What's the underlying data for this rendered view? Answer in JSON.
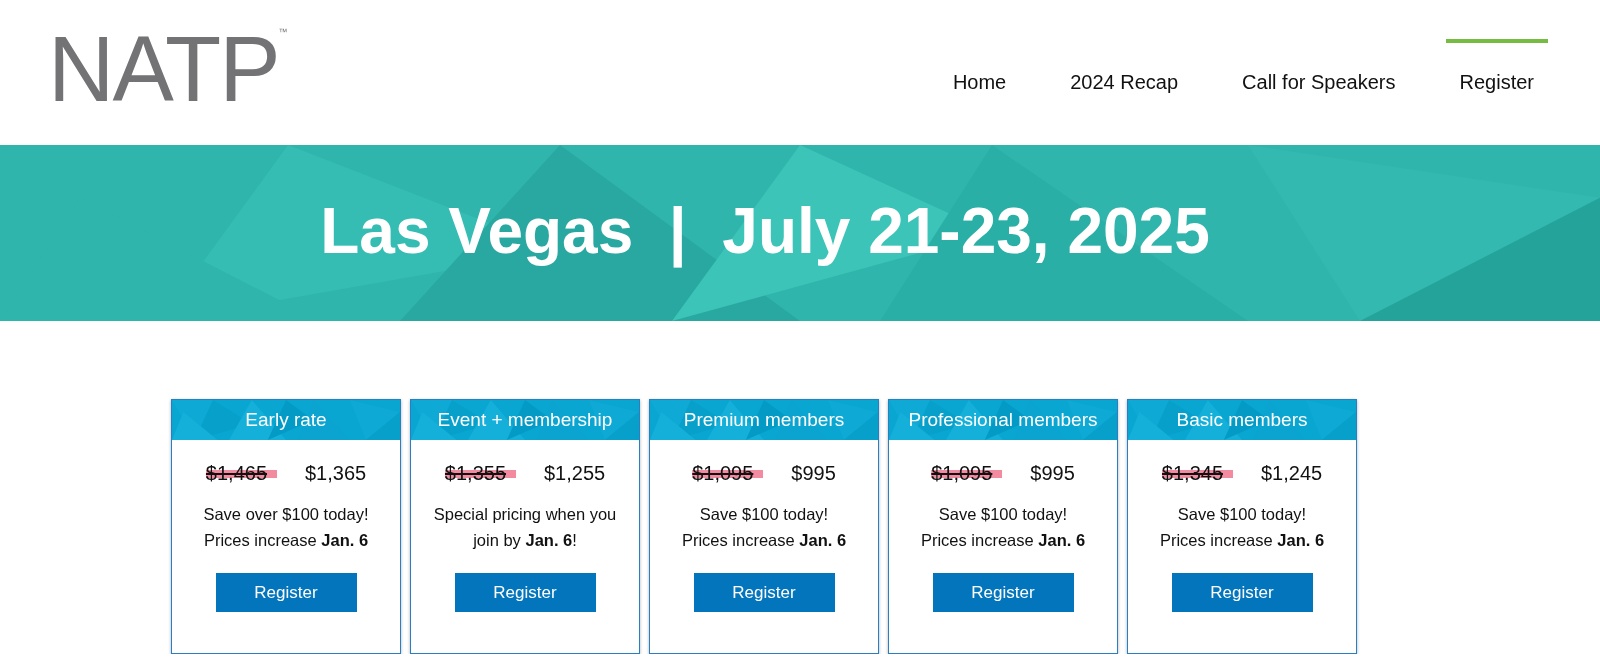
{
  "logo": {
    "text": "NATP",
    "mark": "™"
  },
  "nav": [
    {
      "label": "Home",
      "selected": false
    },
    {
      "label": "2024 Recap",
      "selected": false
    },
    {
      "label": "Call for Speakers",
      "selected": false
    },
    {
      "label": "Register",
      "selected": true
    }
  ],
  "banner": {
    "title": "Las Vegas  |  July 21-23, 2025"
  },
  "plans": [
    {
      "title": "Early rate",
      "old_price": "$1,465",
      "price": "$1,365",
      "lines": [
        "Save over $100 today!",
        "Prices increase **Jan. 6**"
      ],
      "button": "Register"
    },
    {
      "title": "Event + membership",
      "old_price": "$1,355",
      "price": "$1,255",
      "lines": [
        "Special pricing when you",
        "join by **Jan. 6**!"
      ],
      "button": "Register"
    },
    {
      "title": "Premium members",
      "old_price": "$1,095",
      "price": "$995",
      "lines": [
        "Save $100 today!",
        "Prices increase **Jan. 6**"
      ],
      "button": "Register"
    },
    {
      "title": "Professional members",
      "old_price": "$1,095",
      "price": "$995",
      "lines": [
        "Save $100 today!",
        "Prices increase **Jan. 6**"
      ],
      "button": "Register"
    },
    {
      "title": "Basic members",
      "old_price": "$1,345",
      "price": "$1,245",
      "lines": [
        "Save $100 today!",
        "Prices increase **Jan. 6**"
      ],
      "button": "Register"
    }
  ]
}
